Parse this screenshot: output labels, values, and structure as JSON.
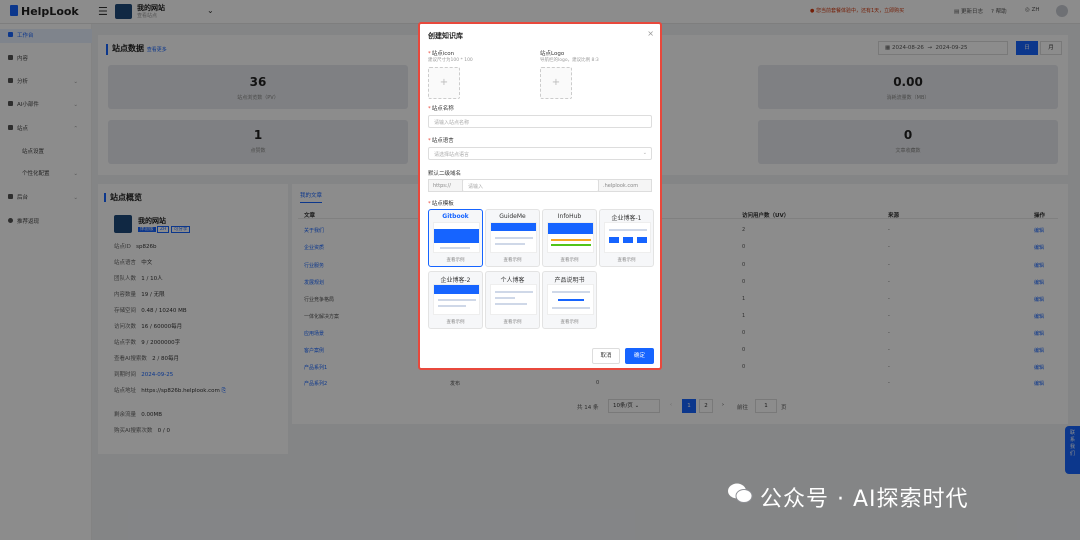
{
  "brand": {
    "name": "HelpLook"
  },
  "site": {
    "name": "我的网站",
    "sub": "查看站点"
  },
  "topbar": {
    "notice": "● 您当前套餐体验中，还有1天，立即购买",
    "update": "更新日志",
    "help": "帮助",
    "lang": "ZH"
  },
  "sidebar": {
    "items": [
      {
        "label": "工作台"
      },
      {
        "label": "内容"
      },
      {
        "label": "分析"
      },
      {
        "label": "AI小部件"
      },
      {
        "label": "站点"
      },
      {
        "label": "站点设置"
      },
      {
        "label": "个性化配置"
      },
      {
        "label": "后台"
      },
      {
        "label": "推荐返现"
      }
    ]
  },
  "main": {
    "title": "站点数据",
    "title_link": "查看更多",
    "date_from": "2024-08-26",
    "date_to": "2024-09-25",
    "btn_day": "日",
    "btn_month": "月",
    "stats": [
      {
        "value": "36",
        "label": "站点浏览数（PV）"
      },
      {
        "value": "0.00",
        "label": "消耗流量数（MB）"
      },
      {
        "value": "1",
        "label": "点赞数"
      },
      {
        "value": "0",
        "label": "文章收藏数"
      }
    ]
  },
  "overview": {
    "title": "站点概览",
    "site_name": "我的网站",
    "tags": [
      "体验版",
      "ZH",
      "可分享"
    ],
    "rows": [
      {
        "k": "站点ID",
        "v": "sp826b"
      },
      {
        "k": "站点语言",
        "v": "中文"
      },
      {
        "k": "团队人数",
        "v": "1 / 10人"
      },
      {
        "k": "内容数量",
        "v": "19 / 无限"
      },
      {
        "k": "存储空间",
        "v": "0.48 / 10240 MB"
      },
      {
        "k": "访问次数",
        "v": "16 / 60000每月"
      },
      {
        "k": "站点字数",
        "v": "9 / 2000000字"
      },
      {
        "k": "查看AI搜索数",
        "v": "2 / 80每月"
      },
      {
        "k": "到期时间",
        "v": "2024-09-25"
      },
      {
        "k": "站点地址",
        "v": "https://sp826b.helplook.com"
      }
    ],
    "remain_label": "剩余流量",
    "remain_val": "0.00MB",
    "ai_label": "购买AI搜索次数",
    "ai_val": "0 / 0"
  },
  "table": {
    "tab": "我的文章",
    "headers": [
      "文章",
      "访问用户数（UV）",
      "来源",
      "操作"
    ],
    "rows": [
      {
        "name": "关于我们",
        "uv": "2",
        "src": "-",
        "op": "编辑"
      },
      {
        "name": "企业资质",
        "uv": "0",
        "src": "-",
        "op": "编辑"
      },
      {
        "name": "行业服务",
        "uv": "0",
        "src": "-",
        "op": "编辑"
      },
      {
        "name": "发展规划",
        "uv": "0",
        "src": "-",
        "op": "编辑"
      },
      {
        "name": "行业竞争格局",
        "uv": "1",
        "src": "-",
        "op": "编辑"
      },
      {
        "name": "一体化解决方案",
        "uv": "1",
        "src": "-",
        "op": "编辑"
      },
      {
        "name": "应用场景",
        "uv": "0",
        "src": "-",
        "op": "编辑"
      },
      {
        "name": "客户案例",
        "uv": "0",
        "src": "-",
        "op": "编辑"
      },
      {
        "name": "产品系列1",
        "uv": "0",
        "src": "-",
        "op": "编辑"
      },
      {
        "name": "产品系列2",
        "mid": "发布",
        "uv": "0",
        "src": "-",
        "op": "编辑"
      }
    ],
    "pager": {
      "total": "共 14 条",
      "size": "10条/页",
      "prev": "‹",
      "p1": "1",
      "p2": "2",
      "next": "›",
      "goto": "前往",
      "page": "1",
      "unit": "页"
    }
  },
  "modal": {
    "title": "创建知识库",
    "icon_label": "站点icon",
    "icon_hint": "建议尺寸为100 * 100",
    "logo_label": "站点Logo",
    "logo_hint": "导航栏的logo，建议比例 8:3",
    "name_label": "站点名称",
    "name_ph": "请输入站点名称",
    "lang_label": "站点语言",
    "lang_ph": "请选择站点语言",
    "domain_label": "默认二级域名",
    "domain_prefix": "https://",
    "domain_ph": "请输入",
    "domain_suffix": ".helplook.com",
    "tpl_label": "站点模板",
    "templates": [
      {
        "name": "Gitbook",
        "demo": "查看示例"
      },
      {
        "name": "GuideMe",
        "demo": "查看示例"
      },
      {
        "name": "InfoHub",
        "demo": "查看示例"
      },
      {
        "name": "企业博客-1",
        "demo": "查看示例"
      },
      {
        "name": "企业博客-2",
        "demo": "查看示例"
      },
      {
        "name": "个人博客",
        "demo": "查看示例"
      },
      {
        "name": "产品说明书",
        "demo": "查看示例"
      }
    ],
    "cancel": "取消",
    "ok": "确定"
  },
  "watermark": {
    "text": "公众号 · AI探索时代"
  },
  "side_tab": {
    "text": "联系我们"
  }
}
